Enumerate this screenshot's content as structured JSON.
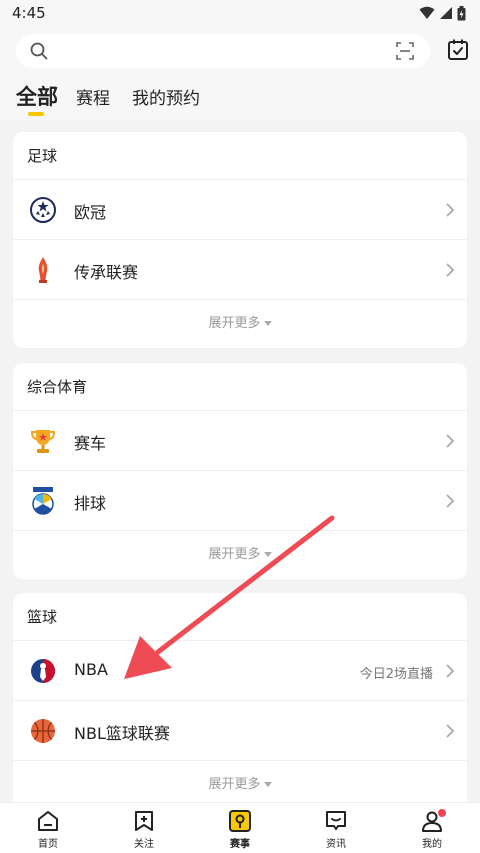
{
  "status_bar": {
    "time": "4:45"
  },
  "tabs": [
    {
      "label": "全部",
      "active": true
    },
    {
      "label": "赛程",
      "active": false
    },
    {
      "label": "我的预约",
      "active": false
    }
  ],
  "sections": [
    {
      "title": "足球",
      "items": [
        {
          "name": "欧冠",
          "extra": "",
          "icon": "champions-league-icon"
        },
        {
          "name": "传承联赛",
          "extra": "",
          "icon": "legacy-league-icon"
        }
      ],
      "more_label": "展开更多"
    },
    {
      "title": "综合体育",
      "items": [
        {
          "name": "赛车",
          "extra": "",
          "icon": "trophy-icon"
        },
        {
          "name": "排球",
          "extra": "",
          "icon": "volleyball-icon"
        }
      ],
      "more_label": "展开更多"
    },
    {
      "title": "篮球",
      "items": [
        {
          "name": "NBA",
          "extra": "今日2场直播",
          "icon": "nba-icon"
        },
        {
          "name": "NBL篮球联赛",
          "extra": "",
          "icon": "basketball-icon"
        }
      ],
      "more_label": "展开更多"
    }
  ],
  "bottom_nav": [
    {
      "label": "首页",
      "icon": "home-icon",
      "active": false
    },
    {
      "label": "关注",
      "icon": "follow-icon",
      "active": false
    },
    {
      "label": "赛事",
      "icon": "events-icon",
      "active": true
    },
    {
      "label": "资讯",
      "icon": "news-icon",
      "active": false
    },
    {
      "label": "我的",
      "icon": "profile-icon",
      "active": false,
      "badge": true
    }
  ],
  "colors": {
    "accent": "#f8c800",
    "arrow": "#ee4b55",
    "badge": "#f0445a"
  }
}
